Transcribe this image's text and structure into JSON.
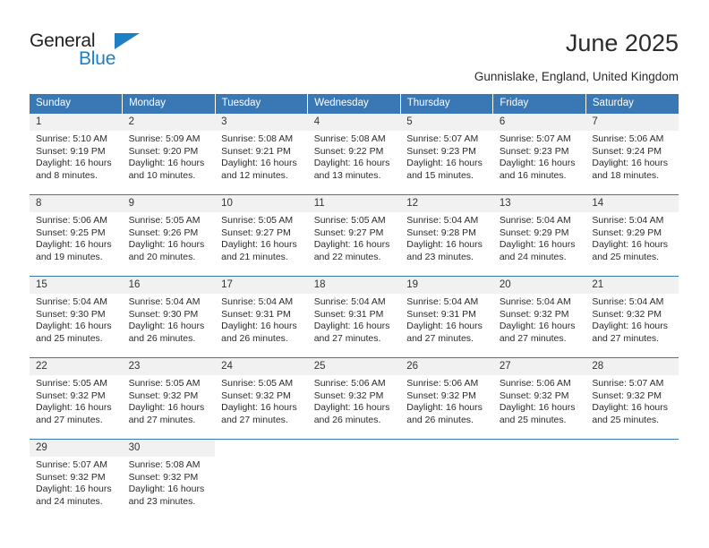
{
  "brand": {
    "name_part1": "General",
    "name_part2": "Blue",
    "accent_color": "#1f7fc4"
  },
  "header": {
    "title": "June 2025",
    "subtitle": "Gunnislake, England, United Kingdom"
  },
  "theme": {
    "header_bg": "#3a78b5",
    "daynum_bg": "#f1f1f1",
    "text_color": "#2b2b2b"
  },
  "calendar": {
    "weekday_headers": [
      "Sunday",
      "Monday",
      "Tuesday",
      "Wednesday",
      "Thursday",
      "Friday",
      "Saturday"
    ],
    "weeks": [
      [
        {
          "day": "1",
          "sunrise": "Sunrise: 5:10 AM",
          "sunset": "Sunset: 9:19 PM",
          "daylight": "Daylight: 16 hours and 8 minutes."
        },
        {
          "day": "2",
          "sunrise": "Sunrise: 5:09 AM",
          "sunset": "Sunset: 9:20 PM",
          "daylight": "Daylight: 16 hours and 10 minutes."
        },
        {
          "day": "3",
          "sunrise": "Sunrise: 5:08 AM",
          "sunset": "Sunset: 9:21 PM",
          "daylight": "Daylight: 16 hours and 12 minutes."
        },
        {
          "day": "4",
          "sunrise": "Sunrise: 5:08 AM",
          "sunset": "Sunset: 9:22 PM",
          "daylight": "Daylight: 16 hours and 13 minutes."
        },
        {
          "day": "5",
          "sunrise": "Sunrise: 5:07 AM",
          "sunset": "Sunset: 9:23 PM",
          "daylight": "Daylight: 16 hours and 15 minutes."
        },
        {
          "day": "6",
          "sunrise": "Sunrise: 5:07 AM",
          "sunset": "Sunset: 9:23 PM",
          "daylight": "Daylight: 16 hours and 16 minutes."
        },
        {
          "day": "7",
          "sunrise": "Sunrise: 5:06 AM",
          "sunset": "Sunset: 9:24 PM",
          "daylight": "Daylight: 16 hours and 18 minutes."
        }
      ],
      [
        {
          "day": "8",
          "sunrise": "Sunrise: 5:06 AM",
          "sunset": "Sunset: 9:25 PM",
          "daylight": "Daylight: 16 hours and 19 minutes."
        },
        {
          "day": "9",
          "sunrise": "Sunrise: 5:05 AM",
          "sunset": "Sunset: 9:26 PM",
          "daylight": "Daylight: 16 hours and 20 minutes."
        },
        {
          "day": "10",
          "sunrise": "Sunrise: 5:05 AM",
          "sunset": "Sunset: 9:27 PM",
          "daylight": "Daylight: 16 hours and 21 minutes."
        },
        {
          "day": "11",
          "sunrise": "Sunrise: 5:05 AM",
          "sunset": "Sunset: 9:27 PM",
          "daylight": "Daylight: 16 hours and 22 minutes."
        },
        {
          "day": "12",
          "sunrise": "Sunrise: 5:04 AM",
          "sunset": "Sunset: 9:28 PM",
          "daylight": "Daylight: 16 hours and 23 minutes."
        },
        {
          "day": "13",
          "sunrise": "Sunrise: 5:04 AM",
          "sunset": "Sunset: 9:29 PM",
          "daylight": "Daylight: 16 hours and 24 minutes."
        },
        {
          "day": "14",
          "sunrise": "Sunrise: 5:04 AM",
          "sunset": "Sunset: 9:29 PM",
          "daylight": "Daylight: 16 hours and 25 minutes."
        }
      ],
      [
        {
          "day": "15",
          "sunrise": "Sunrise: 5:04 AM",
          "sunset": "Sunset: 9:30 PM",
          "daylight": "Daylight: 16 hours and 25 minutes."
        },
        {
          "day": "16",
          "sunrise": "Sunrise: 5:04 AM",
          "sunset": "Sunset: 9:30 PM",
          "daylight": "Daylight: 16 hours and 26 minutes."
        },
        {
          "day": "17",
          "sunrise": "Sunrise: 5:04 AM",
          "sunset": "Sunset: 9:31 PM",
          "daylight": "Daylight: 16 hours and 26 minutes."
        },
        {
          "day": "18",
          "sunrise": "Sunrise: 5:04 AM",
          "sunset": "Sunset: 9:31 PM",
          "daylight": "Daylight: 16 hours and 27 minutes."
        },
        {
          "day": "19",
          "sunrise": "Sunrise: 5:04 AM",
          "sunset": "Sunset: 9:31 PM",
          "daylight": "Daylight: 16 hours and 27 minutes."
        },
        {
          "day": "20",
          "sunrise": "Sunrise: 5:04 AM",
          "sunset": "Sunset: 9:32 PM",
          "daylight": "Daylight: 16 hours and 27 minutes."
        },
        {
          "day": "21",
          "sunrise": "Sunrise: 5:04 AM",
          "sunset": "Sunset: 9:32 PM",
          "daylight": "Daylight: 16 hours and 27 minutes."
        }
      ],
      [
        {
          "day": "22",
          "sunrise": "Sunrise: 5:05 AM",
          "sunset": "Sunset: 9:32 PM",
          "daylight": "Daylight: 16 hours and 27 minutes."
        },
        {
          "day": "23",
          "sunrise": "Sunrise: 5:05 AM",
          "sunset": "Sunset: 9:32 PM",
          "daylight": "Daylight: 16 hours and 27 minutes."
        },
        {
          "day": "24",
          "sunrise": "Sunrise: 5:05 AM",
          "sunset": "Sunset: 9:32 PM",
          "daylight": "Daylight: 16 hours and 27 minutes."
        },
        {
          "day": "25",
          "sunrise": "Sunrise: 5:06 AM",
          "sunset": "Sunset: 9:32 PM",
          "daylight": "Daylight: 16 hours and 26 minutes."
        },
        {
          "day": "26",
          "sunrise": "Sunrise: 5:06 AM",
          "sunset": "Sunset: 9:32 PM",
          "daylight": "Daylight: 16 hours and 26 minutes."
        },
        {
          "day": "27",
          "sunrise": "Sunrise: 5:06 AM",
          "sunset": "Sunset: 9:32 PM",
          "daylight": "Daylight: 16 hours and 25 minutes."
        },
        {
          "day": "28",
          "sunrise": "Sunrise: 5:07 AM",
          "sunset": "Sunset: 9:32 PM",
          "daylight": "Daylight: 16 hours and 25 minutes."
        }
      ],
      [
        {
          "day": "29",
          "sunrise": "Sunrise: 5:07 AM",
          "sunset": "Sunset: 9:32 PM",
          "daylight": "Daylight: 16 hours and 24 minutes."
        },
        {
          "day": "30",
          "sunrise": "Sunrise: 5:08 AM",
          "sunset": "Sunset: 9:32 PM",
          "daylight": "Daylight: 16 hours and 23 minutes."
        },
        {
          "day": "",
          "sunrise": "",
          "sunset": "",
          "daylight": ""
        },
        {
          "day": "",
          "sunrise": "",
          "sunset": "",
          "daylight": ""
        },
        {
          "day": "",
          "sunrise": "",
          "sunset": "",
          "daylight": ""
        },
        {
          "day": "",
          "sunrise": "",
          "sunset": "",
          "daylight": ""
        },
        {
          "day": "",
          "sunrise": "",
          "sunset": "",
          "daylight": ""
        }
      ]
    ]
  }
}
